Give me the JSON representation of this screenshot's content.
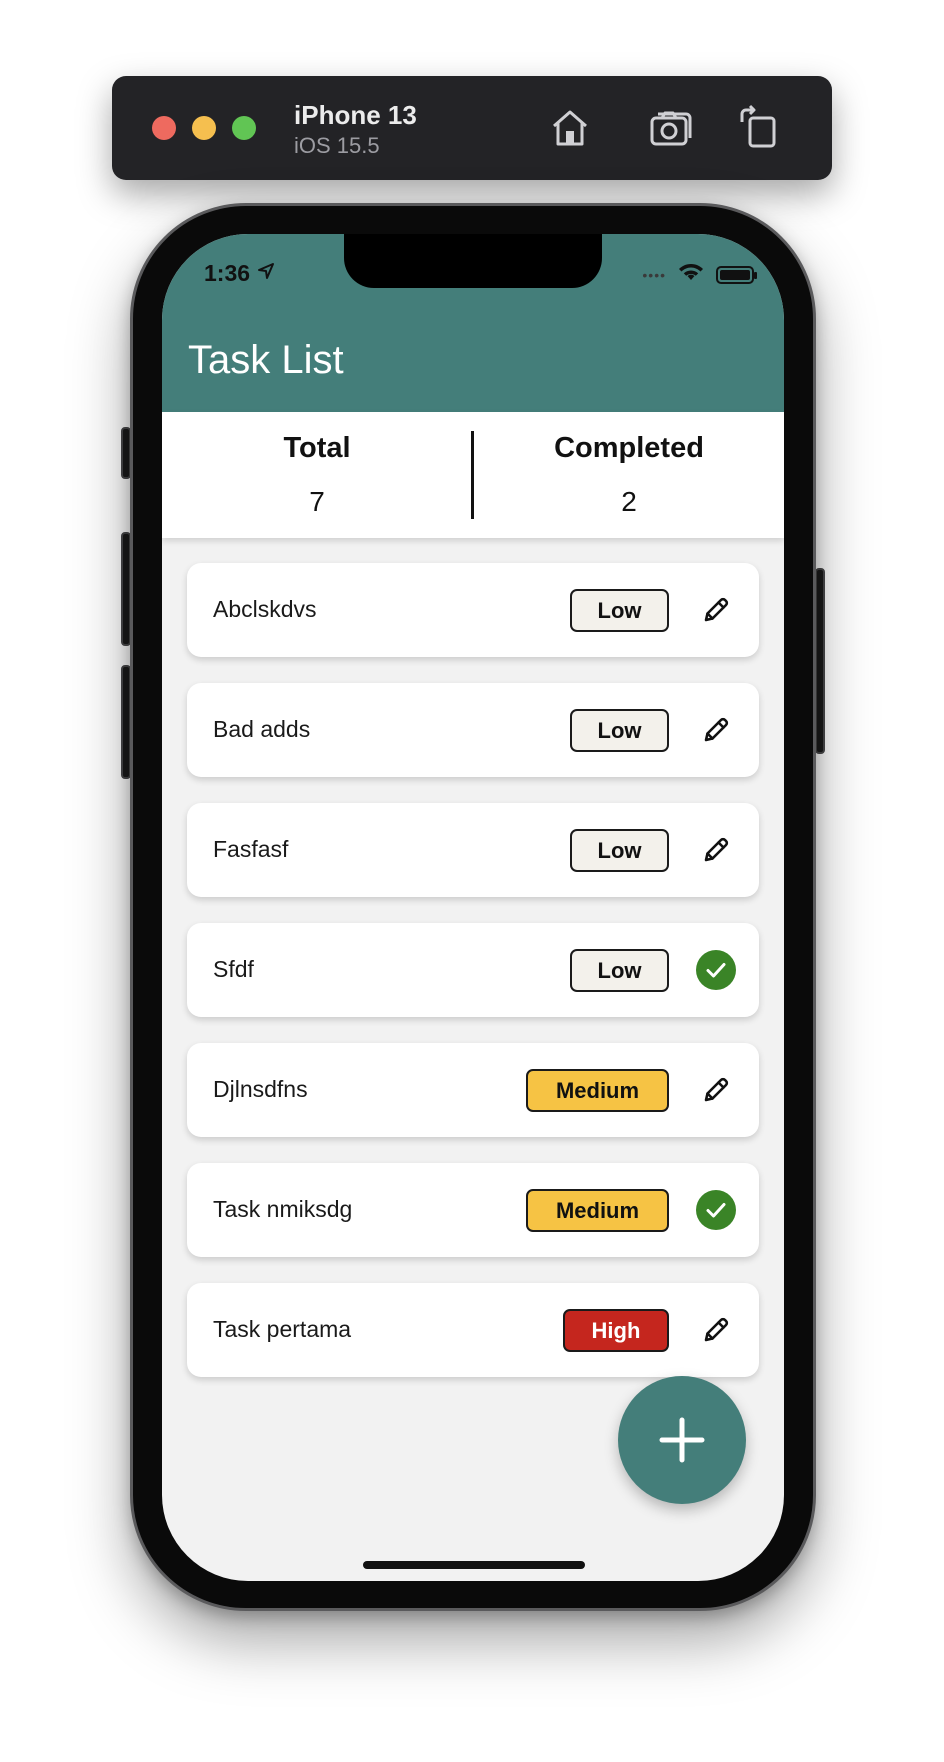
{
  "simulator": {
    "device_name": "iPhone 13",
    "os_version": "iOS 15.5",
    "icons": [
      "home-icon",
      "screenshot-icon",
      "rotate-icon"
    ]
  },
  "status_bar": {
    "time": "1:36",
    "icons": [
      "location-arrow-icon",
      "wifi-icon",
      "battery-icon"
    ]
  },
  "header": {
    "title": "Task List"
  },
  "summary": {
    "total_label": "Total",
    "total_value": "7",
    "completed_label": "Completed",
    "completed_value": "2"
  },
  "tasks": [
    {
      "name": "Abclskdvs",
      "priority": "Low",
      "status": "edit"
    },
    {
      "name": "Bad adds",
      "priority": "Low",
      "status": "edit"
    },
    {
      "name": "Fasfasf",
      "priority": "Low",
      "status": "edit"
    },
    {
      "name": "Sfdf",
      "priority": "Low",
      "status": "completed"
    },
    {
      "name": "Djlnsdfns",
      "priority": "Medium",
      "status": "edit"
    },
    {
      "name": "Task nmiksdg",
      "priority": "Medium",
      "status": "completed"
    },
    {
      "name": "Task pertama",
      "priority": "High",
      "status": "edit"
    }
  ],
  "colors": {
    "primary": "#447e7a",
    "low": "#f3f1eb",
    "medium": "#f6c344",
    "high": "#c5261e",
    "done": "#3a8427"
  },
  "fab": {
    "icon": "plus-icon"
  }
}
